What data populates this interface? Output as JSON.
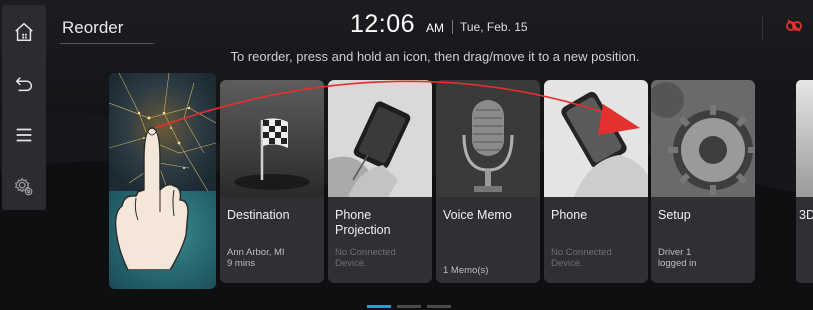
{
  "header": {
    "title": "Reorder",
    "time": "12:06",
    "ampm": "AM",
    "date": "Tue, Feb. 15"
  },
  "instruction": "To reorder, press and hold an icon, then drag/move it to a new position.",
  "sidebar": {
    "items": [
      {
        "icon": "home-icon"
      },
      {
        "icon": "back-icon"
      },
      {
        "icon": "menu-icon"
      },
      {
        "icon": "settings-icon"
      }
    ]
  },
  "cards": [
    {
      "label": "Destination",
      "sub": "Ann Arbor, MI\n9 mins",
      "icon": "checkered-flag"
    },
    {
      "label": "Phone\nProjection",
      "sub": "No Connected\nDevice.",
      "icon": "phone-in-hand"
    },
    {
      "label": "Voice Memo",
      "sub": "1 Memo(s)",
      "icon": "microphone"
    },
    {
      "label": "Phone",
      "sub": "No Connected\nDevice.",
      "icon": "phone-in-hand"
    },
    {
      "label": "Setup",
      "sub": "Driver 1\nlogged in",
      "icon": "gear"
    },
    {
      "label": "3D"
    }
  ],
  "pager": {
    "pages": 3,
    "current": 1
  },
  "colors": {
    "accent": "#1aa6c9",
    "arrow": "#e53030",
    "status": "#e53030"
  }
}
